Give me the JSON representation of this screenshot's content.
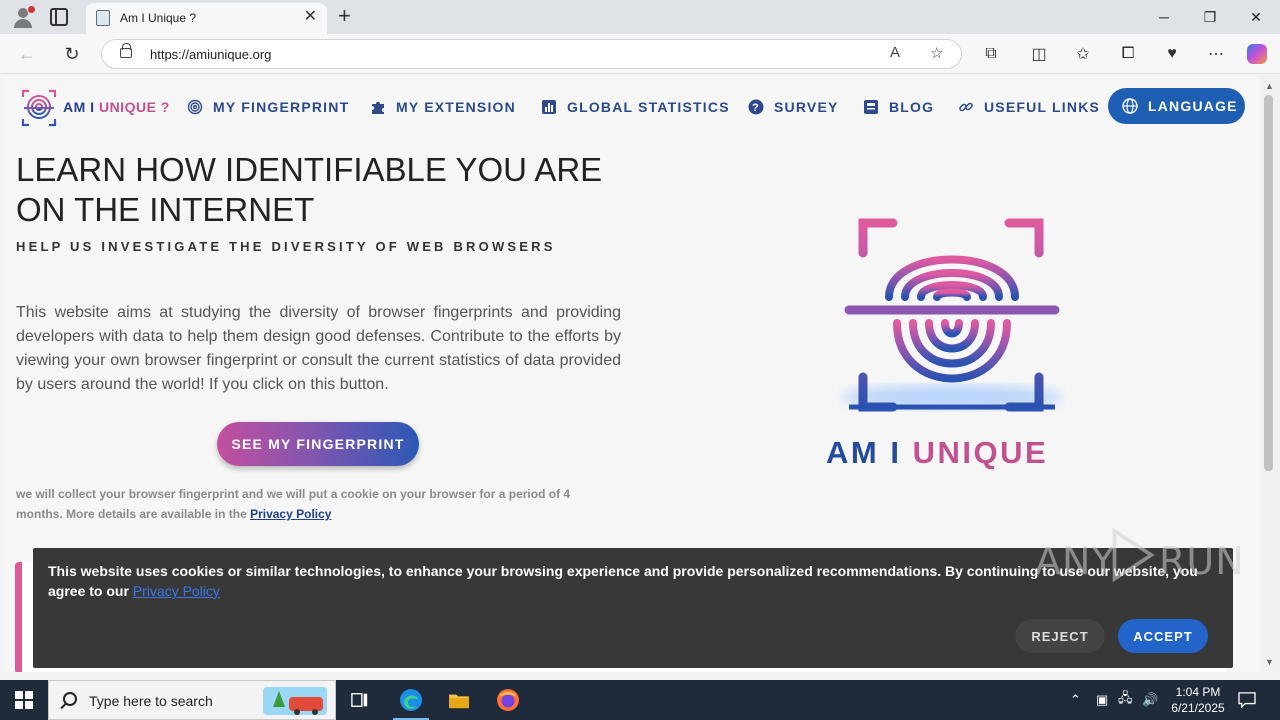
{
  "browser": {
    "tab_title": "Am I Unique ?",
    "url": "https://amiunique.org"
  },
  "site": {
    "brand_part1": "AM I ",
    "brand_part2": "UNIQUE ?",
    "menu": [
      {
        "label": "MY FINGERPRINT",
        "icon": "fingerprint-icon"
      },
      {
        "label": "MY EXTENSION",
        "icon": "puzzle-icon"
      },
      {
        "label": "GLOBAL STATISTICS",
        "icon": "bar-chart-icon"
      },
      {
        "label": "SURVEY",
        "icon": "question-icon"
      },
      {
        "label": "BLOG",
        "icon": "blog-icon"
      },
      {
        "label": "USEFUL LINKS",
        "icon": "link-icon"
      }
    ],
    "language_label": "LANGUAGE",
    "colors": {
      "primary": "#1e5fb3",
      "accent": "#c2528f",
      "nav_text": "#2d4a8a"
    }
  },
  "hero": {
    "title": "LEARN HOW IDENTIFIABLE YOU ARE ON THE INTERNET",
    "subtitle": "HELP US INVESTIGATE THE DIVERSITY OF WEB BROWSERS",
    "body": "This website aims at studying the diversity of browser fingerprints and providing developers with data to help them design good defenses. Contribute to the efforts by viewing your own browser fingerprint or consult the current statistics of data provided by users around the world! If you click on this button.",
    "cta_label": "SEE MY FINGERPRINT",
    "notice_text": "we will collect your browser fingerprint and we will put a cookie on your browser for a period of 4 months. More details are available in the ",
    "notice_link": "Privacy Policy",
    "logo_part1": "AM I ",
    "logo_part2": "UNIQUE"
  },
  "cookie_banner": {
    "message": "This website uses cookies or similar technologies, to enhance your browsing experience and provide personalized recommendations. By continuing to use our website, you agree to our ",
    "link": "Privacy Policy",
    "reject_label": "REJECT",
    "accept_label": "ACCEPT"
  },
  "watermark": {
    "left": "ANY",
    "right": "RUN"
  },
  "taskbar": {
    "search_placeholder": "Type here to search",
    "time": "1:04 PM",
    "date": "6/21/2025"
  }
}
